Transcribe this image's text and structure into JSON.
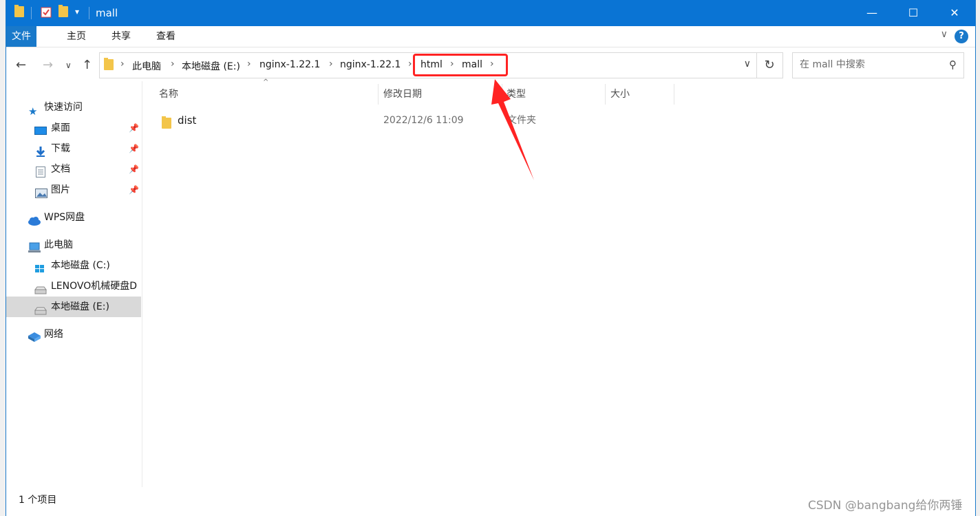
{
  "window": {
    "title": "mall",
    "qa_dropdown": "▾"
  },
  "window_controls": {
    "minimize": "—",
    "maximize": "☐",
    "close": "✕"
  },
  "ribbon": {
    "tabs": [
      "文件",
      "主页",
      "共享",
      "查看"
    ],
    "collapse": "∨",
    "help": "?"
  },
  "nav": {
    "back": "←",
    "forward": "→",
    "recent": "∨",
    "up": "↑",
    "refresh": "↻"
  },
  "breadcrumb": {
    "items": [
      "此电脑",
      "本地磁盘 (E:)",
      "nginx-1.22.1",
      "nginx-1.22.1",
      "html",
      "mall"
    ],
    "separator": "›",
    "dropdown": "∨"
  },
  "search": {
    "placeholder": "在 mall 中搜索",
    "icon": "search-icon",
    "glyph": "⚲"
  },
  "sidebar": {
    "quick_access": {
      "label": "快速访问",
      "items": [
        {
          "label": "桌面",
          "icon": "desktop-icon",
          "pinned": true
        },
        {
          "label": "下载",
          "icon": "download-icon",
          "pinned": true
        },
        {
          "label": "文档",
          "icon": "document-icon",
          "pinned": true
        },
        {
          "label": "图片",
          "icon": "pictures-icon",
          "pinned": true
        }
      ]
    },
    "wps": "WPS网盘",
    "this_pc": {
      "label": "此电脑",
      "drives": [
        "本地磁盘 (C:)",
        "LENOVO机械硬盘D",
        "本地磁盘 (E:)"
      ],
      "selected": "本地磁盘 (E:)"
    },
    "network": "网络",
    "pin_glyph": "📌"
  },
  "columns": {
    "name": "名称",
    "modified": "修改日期",
    "type": "类型",
    "size": "大小",
    "sort_glyph": "^"
  },
  "files": [
    {
      "name": "dist",
      "modified": "2022/12/6 11:09",
      "type": "文件夹",
      "size": ""
    }
  ],
  "status": "1 个项目",
  "watermark": "CSDN @bangbang给你两锤",
  "colors": {
    "titlebar": "#0a74d4",
    "accent": "#1979ca",
    "highlight": "#ff2323",
    "selected": "#d9d9d9"
  }
}
